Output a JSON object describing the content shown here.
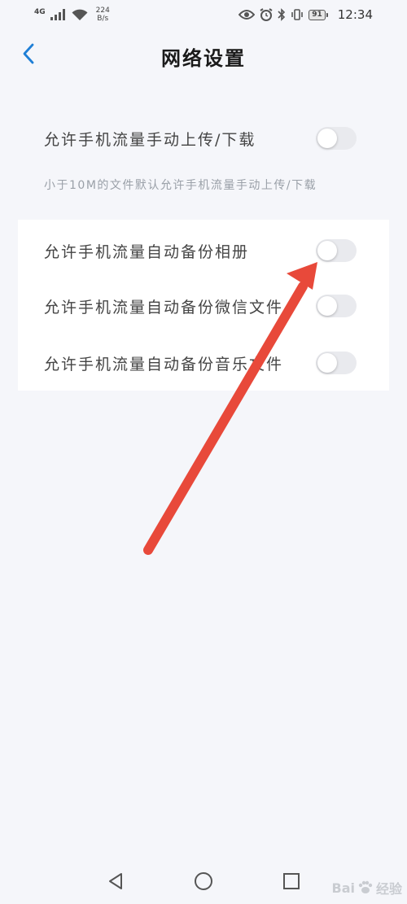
{
  "status_bar": {
    "network": "4G",
    "speed_value": "224",
    "speed_unit": "B/s",
    "battery": "91",
    "time": "12:34"
  },
  "header": {
    "title": "网络设置"
  },
  "settings": {
    "manual_transfer": {
      "label": "允许手机流量手动上传/下载",
      "enabled": false,
      "hint": "小于10M的文件默认允许手机流量手动上传/下载"
    },
    "auto_backup": [
      {
        "label": "允许手机流量自动备份相册",
        "enabled": false
      },
      {
        "label": "允许手机流量自动备份微信文件",
        "enabled": false
      },
      {
        "label": "允许手机流量自动备份音乐文件",
        "enabled": false
      }
    ]
  },
  "watermark": {
    "text": "Bai",
    "text2": "经验"
  },
  "colors": {
    "accent": "#1f7fd6",
    "background": "#f5f6fa",
    "arrow": "#e8493a"
  }
}
